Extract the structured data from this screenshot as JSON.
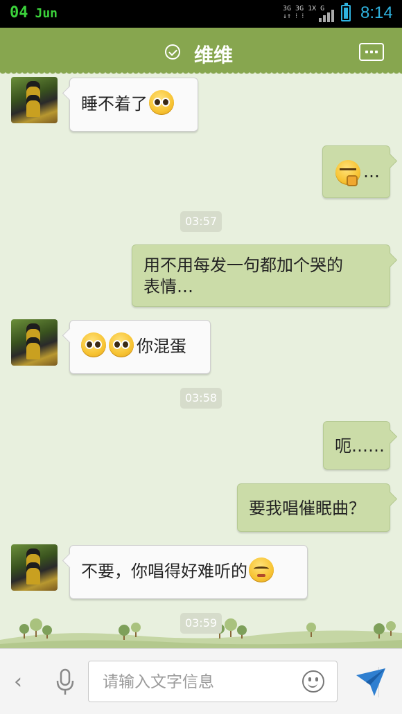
{
  "status_bar": {
    "day": "04",
    "month": "Jun",
    "network_line1": "3G 3G 1X G",
    "network_line2": "↓↑ ⁝ ⁝ ",
    "time": "8:14"
  },
  "title_bar": {
    "contact_name": "维维",
    "verified_icon": "check-circle-icon",
    "menu_icon": "more-icon"
  },
  "messages": [
    {
      "dir": "in",
      "text": "睡不着了",
      "emoji_after": "cry"
    },
    {
      "dir": "out",
      "text": "…",
      "emoji_before": "think"
    },
    {
      "type": "time",
      "text": "03:57"
    },
    {
      "dir": "out",
      "text_line1": "用不用每发一句都加个哭的",
      "text_line2": "表情…"
    },
    {
      "dir": "in",
      "text": "你混蛋",
      "emoji_before": "cry cry"
    },
    {
      "type": "time",
      "text": "03:58"
    },
    {
      "dir": "out",
      "text": "呃……"
    },
    {
      "dir": "out",
      "text": "要我唱催眠曲？"
    },
    {
      "dir": "in",
      "text": "不要，你唱得好难听的",
      "emoji_after": "pout"
    },
    {
      "type": "time",
      "text": "03:59"
    }
  ],
  "input_bar": {
    "placeholder": "请输入文字信息",
    "back_icon": "chevron-left-icon",
    "voice_icon": "microphone-icon",
    "emoji_icon": "smiley-icon",
    "send_icon": "send-icon"
  },
  "colors": {
    "title_bar": "#87a64f",
    "background": "#e8f0de",
    "outgoing_bubble": "#cbdca8",
    "incoming_bubble": "#fafafa",
    "time_accent": "#2fb3e0"
  }
}
